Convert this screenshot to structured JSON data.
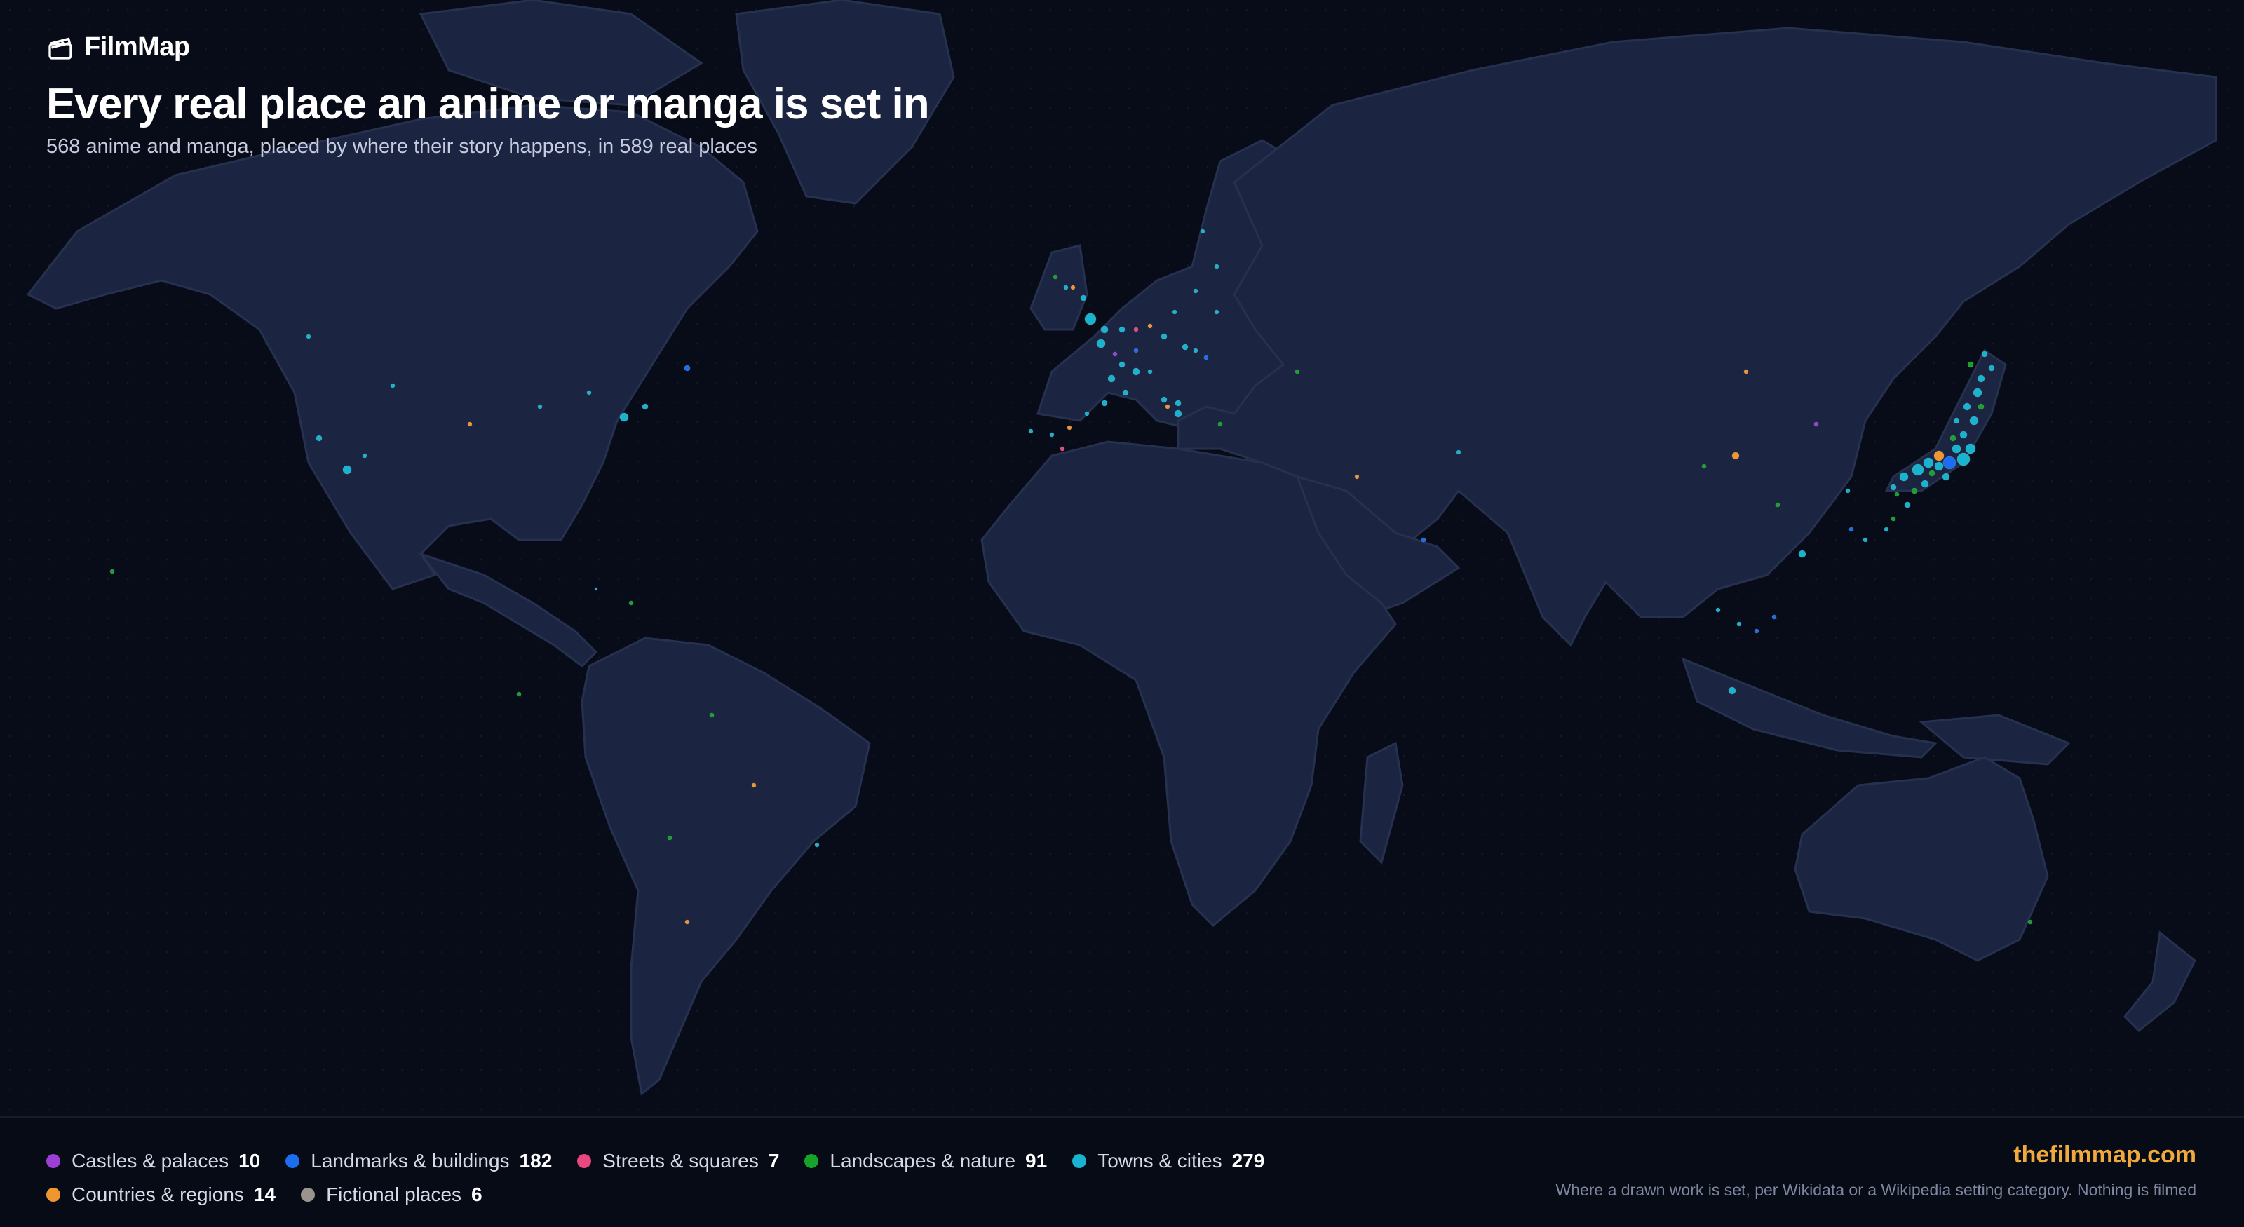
{
  "brand": {
    "name": "FilmMap",
    "icon": "clapperboard-icon"
  },
  "title": "Every real place an anime or manga is set in",
  "subtitle": "568 anime and manga, placed by where their story happens, in 589 real places",
  "legend": [
    {
      "label": "Castles & palaces",
      "count": "10",
      "color": "#9b3fd6"
    },
    {
      "label": "Landmarks & buildings",
      "count": "182",
      "color": "#1c6ef0"
    },
    {
      "label": "Streets & squares",
      "count": "7",
      "color": "#e8477f"
    },
    {
      "label": "Landscapes & nature",
      "count": "91",
      "color": "#17a32a"
    },
    {
      "label": "Towns & cities",
      "count": "279",
      "color": "#17b3cf"
    },
    {
      "label": "Countries & regions",
      "count": "14",
      "color": "#f0962e"
    },
    {
      "label": "Fictional places",
      "count": "6",
      "color": "#9a948d"
    }
  ],
  "site_link": "thefilmmap.com",
  "footnote": "Where a drawn work is set, per Wikidata or a Wikipedia setting category. Nothing is filmed"
}
